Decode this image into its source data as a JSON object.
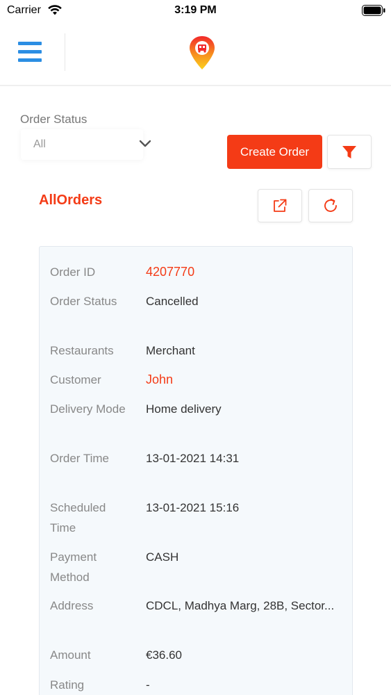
{
  "status_bar": {
    "carrier": "Carrier",
    "time": "3:19 PM"
  },
  "filters": {
    "order_status_label": "Order Status",
    "order_status_value": "All",
    "create_order_label": "Create Order"
  },
  "section": {
    "title": "AllOrders"
  },
  "order": {
    "rows": [
      {
        "label": "Order ID",
        "value": "4207770",
        "accent": true
      },
      {
        "label": "Order Status",
        "value": "Cancelled",
        "accent": false
      },
      {
        "label": "Restaurants",
        "value": "Merchant",
        "accent": false
      },
      {
        "label": "Customer",
        "value": "John",
        "accent": true
      },
      {
        "label": "Delivery Mode",
        "value": "Home delivery",
        "accent": false
      },
      {
        "label": "Order Time",
        "value": "13-01-2021 14:31",
        "accent": false
      },
      {
        "label": "Scheduled Time",
        "value": "13-01-2021 15:16",
        "accent": false
      },
      {
        "label": "Payment Method",
        "value": "CASH",
        "accent": false
      },
      {
        "label": "Address",
        "value": "CDCL, Madhya Marg, 28B, Sector...",
        "accent": false
      },
      {
        "label": "Amount",
        "value": "€36.60",
        "accent": false
      },
      {
        "label": "Rating",
        "value": "-",
        "accent": false
      }
    ]
  },
  "colors": {
    "accent": "#f43b16",
    "menu": "#2c8ee3",
    "card_bg": "#f5f9fc"
  },
  "icons": {
    "menu": "hamburger-icon",
    "logo": "location-pin-logo",
    "chevron": "chevron-down-icon",
    "filter": "funnel-icon",
    "export": "external-link-icon",
    "refresh": "refresh-icon"
  }
}
